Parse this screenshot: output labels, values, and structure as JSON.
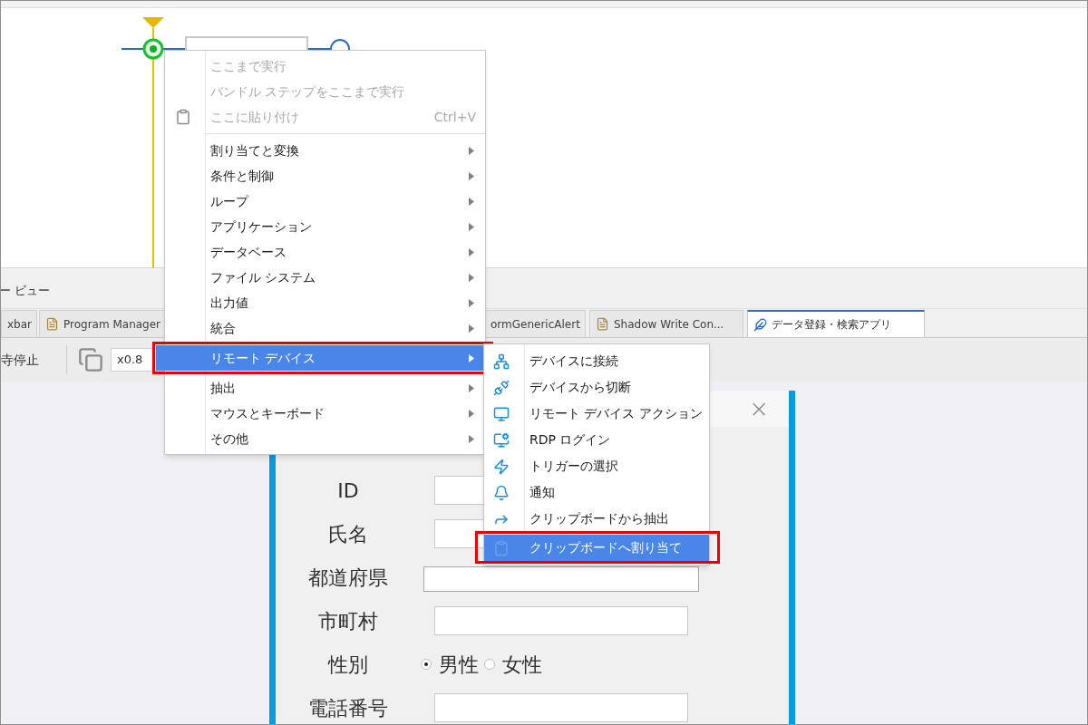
{
  "panel": {
    "title": "ー ビュー"
  },
  "tabs": [
    {
      "label": "xbar",
      "selected": false
    },
    {
      "label": "Program Manager",
      "selected": false
    },
    {
      "label": "ormGenericAlert",
      "selected": false
    },
    {
      "label": "Shadow Write Con...",
      "selected": false
    },
    {
      "label": "データ登録・検索アプリ",
      "selected": true
    }
  ],
  "toolbar": {
    "pause_label": "寺停止",
    "speed": "x0.8"
  },
  "form": {
    "close": "×",
    "rows": [
      {
        "kind": "text",
        "label": "ID"
      },
      {
        "kind": "text",
        "label": "氏名"
      },
      {
        "kind": "select",
        "label": "都道府県"
      },
      {
        "kind": "text",
        "label": "市町村"
      },
      {
        "kind": "radio",
        "label": "性別",
        "options": [
          {
            "label": "男性",
            "selected": true
          },
          {
            "label": "女性",
            "selected": false
          }
        ]
      },
      {
        "kind": "text",
        "label": "電話番号"
      }
    ]
  },
  "context_menu": {
    "items": [
      {
        "kind": "item",
        "label": "ここまで実行",
        "disabled": true
      },
      {
        "kind": "item",
        "label": "バンドル ステップをここまで実行",
        "disabled": true
      },
      {
        "kind": "item",
        "label": "ここに貼り付け",
        "disabled": true,
        "shortcut": "Ctrl+V"
      },
      {
        "kind": "separator"
      },
      {
        "kind": "submenu",
        "label": "割り当てと変換",
        "selected": false
      },
      {
        "kind": "submenu",
        "label": "条件と制御",
        "selected": false
      },
      {
        "kind": "submenu",
        "label": "ループ",
        "selected": false
      },
      {
        "kind": "submenu",
        "label": "アプリケーション",
        "selected": false
      },
      {
        "kind": "submenu",
        "label": "データベース",
        "selected": false
      },
      {
        "kind": "submenu",
        "label": "ファイル システム",
        "selected": false
      },
      {
        "kind": "submenu",
        "label": "出力値",
        "selected": false
      },
      {
        "kind": "submenu",
        "label": "統合",
        "selected": false
      },
      {
        "kind": "submenu",
        "label": "リモート デバイス",
        "selected": true
      },
      {
        "kind": "submenu",
        "label": "抽出",
        "selected": false
      },
      {
        "kind": "submenu",
        "label": "マウスとキーボード",
        "selected": false
      },
      {
        "kind": "submenu",
        "label": "その他",
        "selected": false
      }
    ]
  },
  "submenu": {
    "items": [
      {
        "label": "デバイスに接続",
        "selected": false
      },
      {
        "label": "デバイスから切断",
        "selected": false
      },
      {
        "label": "リモート デバイス アクション",
        "selected": false
      },
      {
        "label": "RDP ログイン",
        "selected": false
      },
      {
        "label": "トリガーの選択",
        "selected": false
      },
      {
        "label": "通知",
        "selected": false
      },
      {
        "label": "クリップボードから抽出",
        "selected": false
      },
      {
        "label": "クリップボードへ割り当て",
        "selected": true
      }
    ]
  }
}
